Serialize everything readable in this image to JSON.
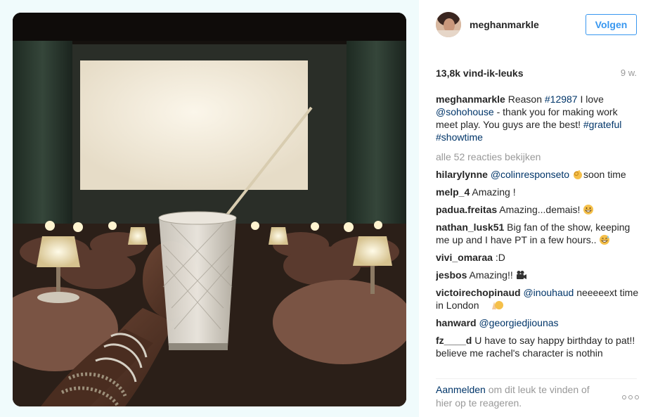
{
  "post": {
    "username": "meghanmarkle",
    "follow_label": "Volgen",
    "likes": "13,8k vind-ik-leuks",
    "age": "9 w.",
    "caption": {
      "user": "meghanmarkle",
      "text_1": "Reason ",
      "tag_1": "#12987",
      "text_2": " I love ",
      "mention": "@sohohouse",
      "text_3": " - thank you for making work meet play. You guys are the best! ",
      "tag_2": "#grateful",
      "tag_3": "#showtime"
    },
    "view_all": "alle 52 reacties bekijken",
    "comments": [
      {
        "user": "hilarylynne",
        "mention": "@colinresponseto",
        "text": "soon time",
        "emoji": "ok-hand"
      },
      {
        "user": "melp_4",
        "text": "Amazing !"
      },
      {
        "user": "padua.freitas",
        "text": "Amazing...demais!",
        "emoji": "grinning-face"
      },
      {
        "user": "nathan_lusk51",
        "text": "Big fan of the show, keeping me up and I have PT in a few hours..",
        "emoji": "sweat-smile"
      },
      {
        "user": "vivi_omaraa",
        "text": ":D"
      },
      {
        "user": "jesbos",
        "text": "Amazing!!",
        "emoji": "movie-camera"
      },
      {
        "user": "victoirechopinaud",
        "mention": "@inouhaud",
        "text": "neeeeext time in London",
        "emoji": "pray-kiss-dancers"
      },
      {
        "user": "hanward",
        "mention": "@georgiedjiounas",
        "text": ""
      },
      {
        "user": "fz____d",
        "text": "U have to say happy birthday to pat!! believe me rachel's character is nothin"
      }
    ],
    "footer": {
      "login": "Aanmelden",
      "rest": " om dit leuk te vinden of hier op te reageren."
    }
  },
  "colors": {
    "accent": "#3897f0",
    "link": "#003569",
    "muted": "#999999",
    "page_bg": "#f0fbfc"
  }
}
